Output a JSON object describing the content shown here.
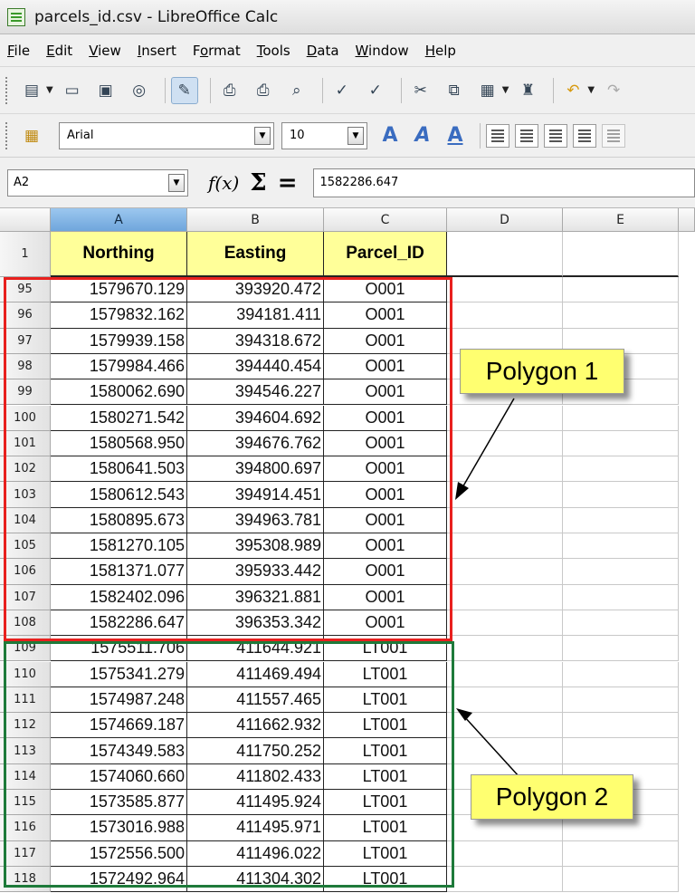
{
  "window": {
    "title": "parcels_id.csv - LibreOffice Calc"
  },
  "menu": [
    {
      "label": "File",
      "u": "F",
      "rest": "ile"
    },
    {
      "label": "Edit",
      "u": "E",
      "rest": "dit"
    },
    {
      "label": "View",
      "u": "V",
      "rest": "iew"
    },
    {
      "label": "Insert",
      "u": "I",
      "rest": "nsert"
    },
    {
      "label": "Format",
      "pre": "F",
      "u": "o",
      "rest": "rmat"
    },
    {
      "label": "Tools",
      "u": "T",
      "rest": "ools"
    },
    {
      "label": "Data",
      "u": "D",
      "rest": "ata"
    },
    {
      "label": "Window",
      "u": "W",
      "rest": "indow"
    },
    {
      "label": "Help",
      "u": "H",
      "rest": "elp"
    }
  ],
  "toolbar": {
    "font_name": "Arial",
    "font_size": "10"
  },
  "formula_bar": {
    "cell_ref": "A2",
    "fx_label": "f(x)",
    "sigma_label": "Σ",
    "equals_label": "=",
    "content": "1582286.647"
  },
  "sheet": {
    "columns": [
      "A",
      "B",
      "C",
      "D",
      "E"
    ],
    "selected_column": "A",
    "header_row": {
      "row": "1",
      "cells": [
        "Northing",
        "Easting",
        "Parcel_ID"
      ]
    },
    "rows": [
      {
        "row": "95",
        "cells": [
          "1579670.129",
          "393920.472",
          "O001"
        ]
      },
      {
        "row": "96",
        "cells": [
          "1579832.162",
          "394181.411",
          "O001"
        ]
      },
      {
        "row": "97",
        "cells": [
          "1579939.158",
          "394318.672",
          "O001"
        ]
      },
      {
        "row": "98",
        "cells": [
          "1579984.466",
          "394440.454",
          "O001"
        ]
      },
      {
        "row": "99",
        "cells": [
          "1580062.690",
          "394546.227",
          "O001"
        ]
      },
      {
        "row": "100",
        "cells": [
          "1580271.542",
          "394604.692",
          "O001"
        ]
      },
      {
        "row": "101",
        "cells": [
          "1580568.950",
          "394676.762",
          "O001"
        ]
      },
      {
        "row": "102",
        "cells": [
          "1580641.503",
          "394800.697",
          "O001"
        ]
      },
      {
        "row": "103",
        "cells": [
          "1580612.543",
          "394914.451",
          "O001"
        ]
      },
      {
        "row": "104",
        "cells": [
          "1580895.673",
          "394963.781",
          "O001"
        ]
      },
      {
        "row": "105",
        "cells": [
          "1581270.105",
          "395308.989",
          "O001"
        ]
      },
      {
        "row": "106",
        "cells": [
          "1581371.077",
          "395933.442",
          "O001"
        ]
      },
      {
        "row": "107",
        "cells": [
          "1582402.096",
          "396321.881",
          "O001"
        ]
      },
      {
        "row": "108",
        "cells": [
          "1582286.647",
          "396353.342",
          "O001"
        ]
      },
      {
        "row": "109",
        "cells": [
          "1575511.706",
          "411644.921",
          "LT001"
        ]
      },
      {
        "row": "110",
        "cells": [
          "1575341.279",
          "411469.494",
          "LT001"
        ]
      },
      {
        "row": "111",
        "cells": [
          "1574987.248",
          "411557.465",
          "LT001"
        ]
      },
      {
        "row": "112",
        "cells": [
          "1574669.187",
          "411662.932",
          "LT001"
        ]
      },
      {
        "row": "113",
        "cells": [
          "1574349.583",
          "411750.252",
          "LT001"
        ]
      },
      {
        "row": "114",
        "cells": [
          "1574060.660",
          "411802.433",
          "LT001"
        ]
      },
      {
        "row": "115",
        "cells": [
          "1573585.877",
          "411495.924",
          "LT001"
        ]
      },
      {
        "row": "116",
        "cells": [
          "1573016.988",
          "411495.971",
          "LT001"
        ]
      },
      {
        "row": "117",
        "cells": [
          "1572556.500",
          "411496.022",
          "LT001"
        ]
      },
      {
        "row": "118",
        "cells": [
          "1572492.964",
          "411304.302",
          "LT001"
        ]
      }
    ]
  },
  "annotations": {
    "polygon1": {
      "label": "Polygon 1",
      "color": "#e8201e"
    },
    "polygon2": {
      "label": "Polygon 2",
      "color": "#1e7a3a"
    },
    "callout_color": "#ffff70"
  }
}
